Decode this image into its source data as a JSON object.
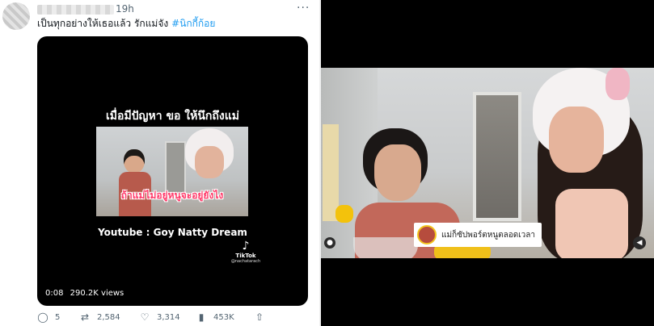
{
  "tweet": {
    "time": "19h",
    "more": "···",
    "text": "เป็นทุกอย่างให้เธอแล้ว รักแม่จัง",
    "hashtag": "#นิกกี้ก้อย",
    "video": {
      "title": "เมื่อมีปัญหา ขอ ให้นึกถึงแม่",
      "caption": "ถ้าแม่ไม่อยู่หนูจะอยู่ยังไง",
      "source": "Youtube : Goy Natty Dream",
      "tiktok_name": "TikTok",
      "tiktok_user": "@nachatarach",
      "duration": "0:08",
      "views": "290.2K views"
    },
    "actions": {
      "replies": "5",
      "retweets": "2,584",
      "likes": "3,314",
      "views": "453K"
    }
  },
  "frame": {
    "caption": "แม่ก็ซัปพอร์ตหนูตลอดเวลา"
  },
  "icons": {
    "reply": "reply-icon",
    "retweet": "retweet-icon",
    "like": "heart-icon",
    "views": "bar-chart-icon",
    "share": "share-icon"
  }
}
